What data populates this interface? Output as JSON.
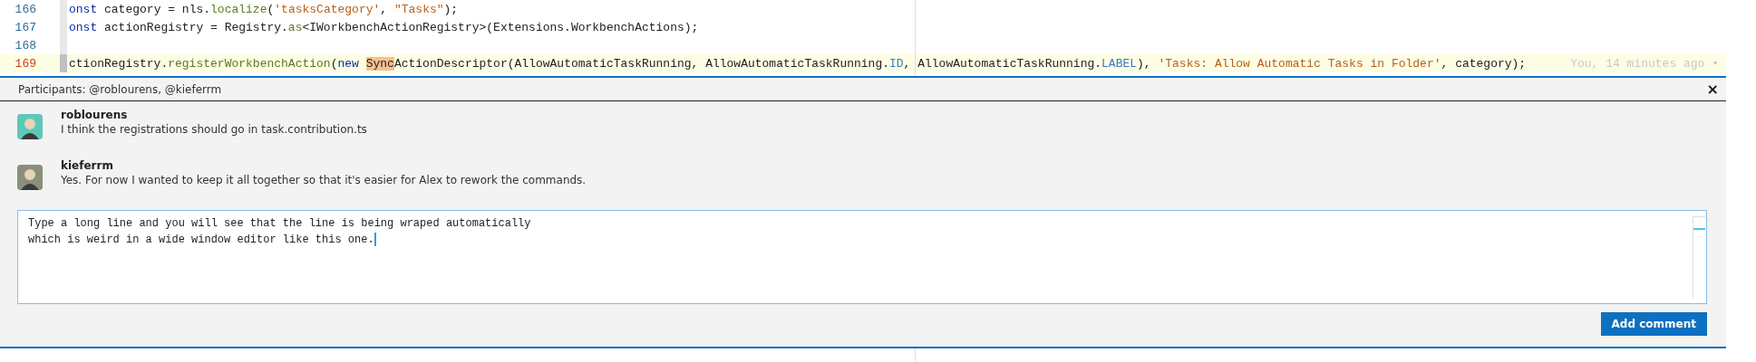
{
  "code_lines": [
    {
      "number": "166",
      "current": false,
      "tokens": [
        {
          "kind": "keyword",
          "text": "onst"
        },
        {
          "kind": "plain",
          "text": " category = nls."
        },
        {
          "kind": "method",
          "text": "localize"
        },
        {
          "kind": "plain",
          "text": "("
        },
        {
          "kind": "string",
          "text": "'tasksCategory'"
        },
        {
          "kind": "plain",
          "text": ", "
        },
        {
          "kind": "string",
          "text": "\"Tasks\""
        },
        {
          "kind": "plain",
          "text": ");"
        }
      ]
    },
    {
      "number": "167",
      "current": false,
      "tokens": [
        {
          "kind": "keyword",
          "text": "onst"
        },
        {
          "kind": "plain",
          "text": " actionRegistry = Registry."
        },
        {
          "kind": "method",
          "text": "as"
        },
        {
          "kind": "plain",
          "text": "<IWorkbenchActionRegistry>(Extensions.WorkbenchActions);"
        }
      ]
    },
    {
      "number": "168",
      "current": false
    },
    {
      "number": "169",
      "current": true,
      "tokens": [
        {
          "kind": "plain",
          "text": "ctionRegistry."
        },
        {
          "kind": "method",
          "text": "registerWorkbenchAction"
        },
        {
          "kind": "plain",
          "text": "("
        },
        {
          "kind": "keyword",
          "text": "new "
        },
        {
          "kind": "match",
          "text": "Sync"
        },
        {
          "kind": "plain",
          "text": "ActionDescriptor(AllowAutomaticTaskRunning, AllowAutomaticTaskRunning."
        },
        {
          "kind": "property",
          "text": "ID"
        },
        {
          "kind": "plain",
          "text": ", AllowAutomaticTaskRunning."
        },
        {
          "kind": "property",
          "text": "LABEL"
        },
        {
          "kind": "plain",
          "text": "), "
        },
        {
          "kind": "string",
          "text": "'Tasks: Allow Automatic Tasks in Folder'"
        },
        {
          "kind": "plain",
          "text": ", category);"
        }
      ],
      "blame": "You, 14 minutes ago •"
    }
  ],
  "comment_panel": {
    "participants": "Participants: @roblourens, @kieferrm",
    "close": "×",
    "comments": [
      {
        "author": "roblourens",
        "body": "I think the registrations should go in task.contribution.ts"
      },
      {
        "author": "kieferrm",
        "body": "Yes. For now I wanted to keep it all together so that it's easier for Alex to rework the commands."
      }
    ],
    "reply": {
      "value": "Type a long line and you will see that the line is being wraped automatically\nwhich is weird in a wide window editor like this one."
    },
    "submit": "Add comment"
  }
}
